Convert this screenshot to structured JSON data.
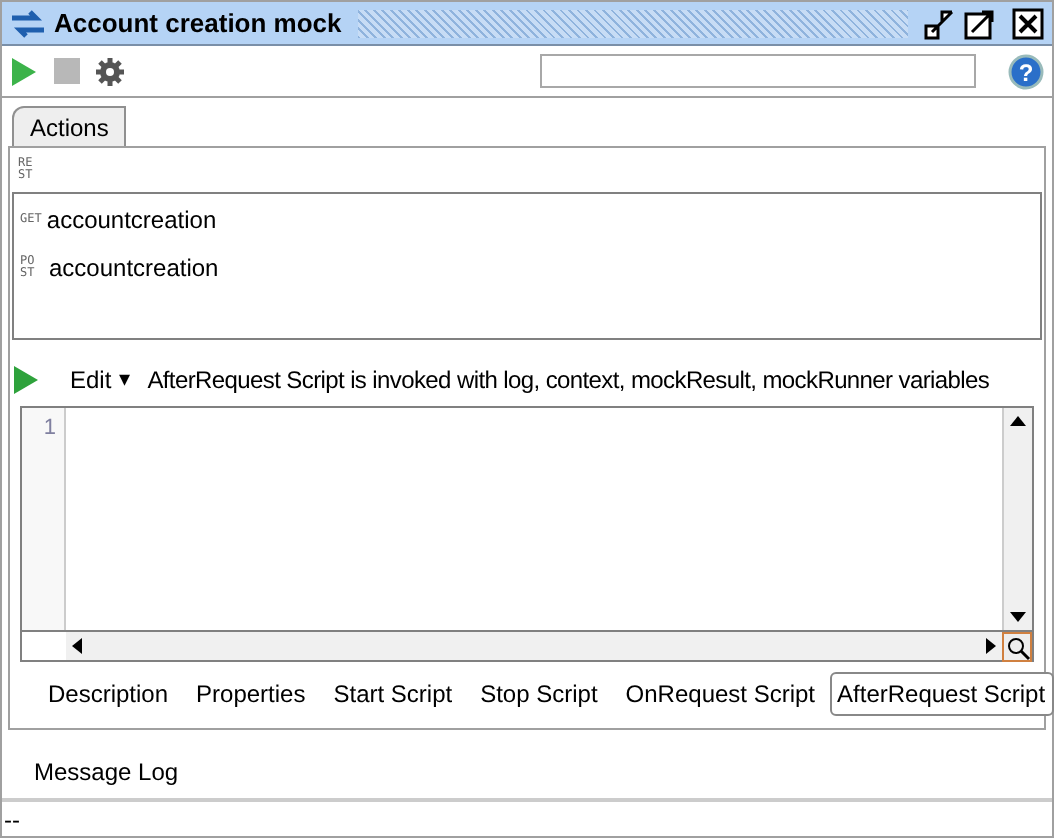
{
  "window": {
    "title": "Account creation mock"
  },
  "toolbar": {
    "help": "?"
  },
  "tabs": [
    {
      "label": "Actions",
      "selected": true
    }
  ],
  "service": {
    "method": "REST"
  },
  "actions": [
    {
      "method": "GET",
      "name": "accountcreation"
    },
    {
      "method": "POST",
      "name": "accountcreation"
    }
  ],
  "script_toolbar": {
    "edit": "Edit",
    "caret": "▾",
    "info": "AfterRequest Script is invoked with log, context, mockResult, mockRunner variables"
  },
  "editor": {
    "line_numbers": [
      "1"
    ]
  },
  "script_tabs": [
    {
      "label": "Description",
      "selected": false
    },
    {
      "label": "Properties",
      "selected": false
    },
    {
      "label": "Start Script",
      "selected": false
    },
    {
      "label": "Stop Script",
      "selected": false
    },
    {
      "label": "OnRequest Script",
      "selected": false
    },
    {
      "label": "AfterRequest Script",
      "selected": true
    }
  ],
  "log_tabs": [
    {
      "label": "Message Log"
    }
  ],
  "status_bar": "--"
}
